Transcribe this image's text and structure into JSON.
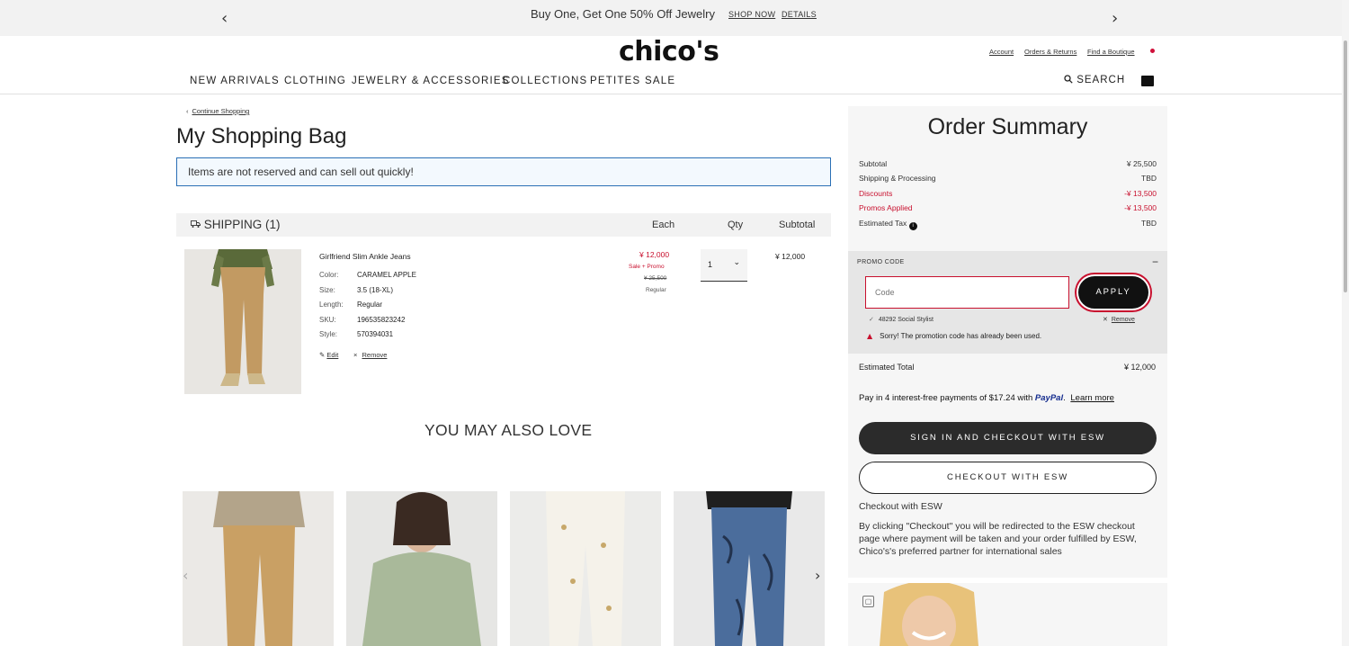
{
  "promo_bar": {
    "message": "Buy One, Get One 50% Off Jewelry",
    "shop_now": "SHOP NOW",
    "details": "DETAILS",
    "prev_icon": "chevron-left-icon",
    "next_icon": "chevron-right-icon"
  },
  "header": {
    "logo": "chico's",
    "account": "Account",
    "orders_returns": "Orders & Returns",
    "find_boutique": "Find a Boutique",
    "nav": [
      "NEW ARRIVALS",
      "CLOTHING",
      "JEWELRY & ACCESSORIES",
      "COLLECTIONS",
      "PETITES",
      "SALE"
    ],
    "search": "SEARCH"
  },
  "bag": {
    "continue_shopping": "Continue Shopping",
    "title": "My Shopping Bag",
    "notice": "Items are not reserved and can sell out quickly!",
    "shipping_label": "SHIPPING (1)",
    "col_each": "Each",
    "col_qty": "Qty",
    "col_subtotal": "Subtotal"
  },
  "item": {
    "name": "Girlfriend Slim Ankle Jeans",
    "attrs": [
      {
        "label": "Color:",
        "value": "CARAMEL APPLE"
      },
      {
        "label": "Size:",
        "value": "3.5 (18-XL)"
      },
      {
        "label": "Length:",
        "value": "Regular"
      },
      {
        "label": "SKU:",
        "value": "196535823242"
      },
      {
        "label": "Style:",
        "value": "570394031"
      }
    ],
    "edit": "Edit",
    "remove": "Remove",
    "price_sale": "¥ 12,000",
    "price_note": "Sale + Promo",
    "price_original": "¥ 25,500",
    "price_regular": "Regular",
    "qty": "1",
    "subtotal": "¥ 12,000"
  },
  "recommendations": {
    "title": "YOU MAY ALSO LOVE"
  },
  "summary": {
    "title": "Order Summary",
    "rows": [
      {
        "label": "Subtotal",
        "value": "¥ 25,500"
      },
      {
        "label": "Shipping & Processing",
        "value": "TBD"
      },
      {
        "label": "Discounts",
        "value": "-¥ 13,500"
      },
      {
        "label": "Promos Applied",
        "value": "-¥ 13,500"
      },
      {
        "label": "Estimated Tax",
        "value": "TBD"
      }
    ],
    "promo_code_label": "PROMO CODE",
    "code_placeholder": "Code",
    "apply": "APPLY",
    "applied_code": "48292 Social Stylist",
    "remove": "Remove",
    "error": "Sorry! The promotion code has already been used.",
    "estimated_total_label": "Estimated Total",
    "estimated_total_value": "¥ 12,000",
    "paypal_text": "Pay in 4 interest-free payments of $17.24 with",
    "paypal_brand": "PayPal",
    "paypal_learn": "Learn more",
    "btn_signin_checkout": "SIGN IN AND CHECKOUT WITH ESW",
    "btn_checkout": "CHECKOUT WITH ESW",
    "esw_caption": "Checkout with ESW",
    "esw_description": "By clicking \"Checkout\" you will be redirected to the ESW checkout page where payment will be taken and your order fulfilled by ESW, Chico's's preferred partner for international sales"
  },
  "colors": {
    "accent_red": "#c8102e",
    "notice_border": "#2a6fb5",
    "paypal_blue": "#142c8e"
  }
}
